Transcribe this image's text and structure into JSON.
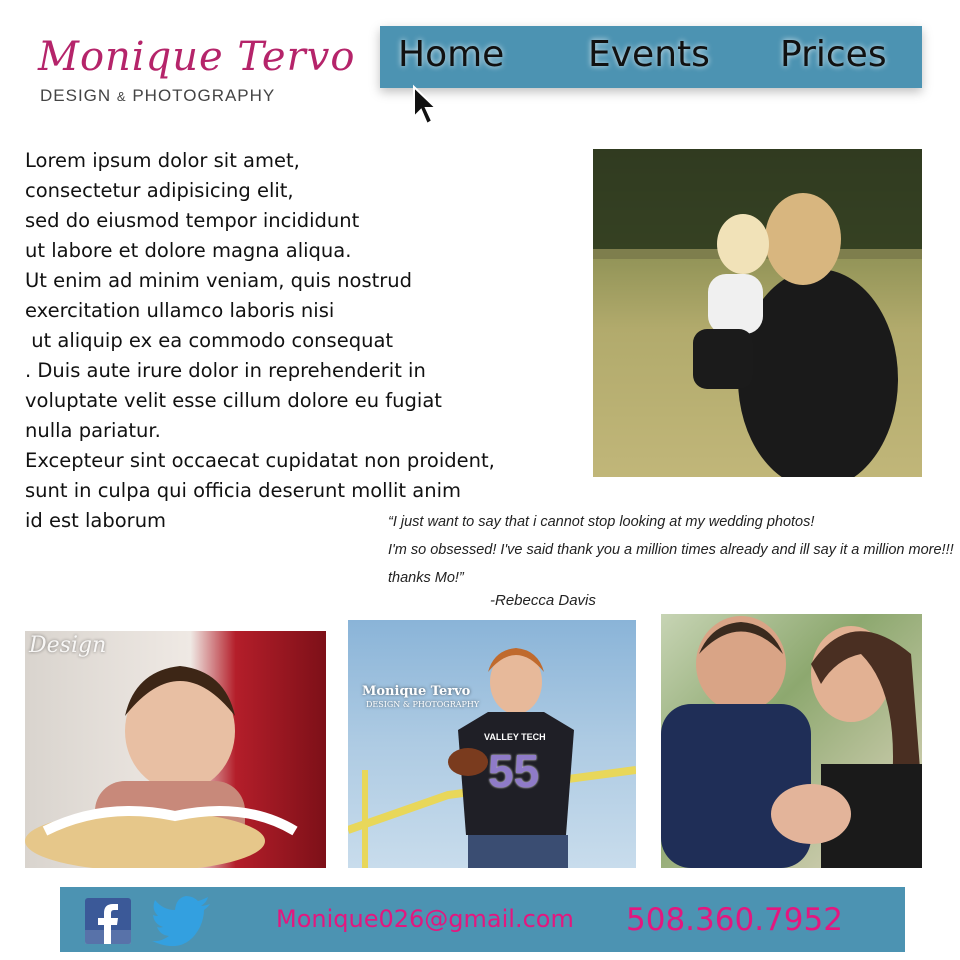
{
  "logo": {
    "script_text": "Monique Tervo",
    "subtitle_part1": "DESIGN",
    "subtitle_amp": "&",
    "subtitle_part2": "PHOTOGRAPHY"
  },
  "nav": {
    "items": [
      {
        "label": "Home"
      },
      {
        "label": "Events"
      },
      {
        "label": "Prices"
      }
    ],
    "bar_color": "#4c93b2"
  },
  "intro": {
    "lines": [
      "Lorem ipsum dolor sit amet,",
      "consectetur adipisicing elit,",
      "sed do eiusmod tempor incididunt",
      "ut labore et dolore magna aliqua.",
      "Ut enim ad minim veniam, quis nostrud",
      "exercitation ullamco laboris nisi",
      " ut aliquip ex ea commodo consequat",
      ". Duis aute irure dolor in reprehenderit in",
      "voluptate velit esse cillum dolore eu fugiat",
      "nulla pariatur.",
      "Excepteur sint occaecat cupidatat non proident,",
      "sunt in culpa qui officia deserunt mollit anim",
      "id est laborum"
    ]
  },
  "testimonial": {
    "lines": [
      "“I just want to say that i cannot stop looking at my wedding photos!",
      "I'm so obsessed! I've said thank you a million times already and ill say it a million more!!!",
      "thanks Mo!”"
    ],
    "author": "-Rebecca Davis"
  },
  "photos": {
    "baby_watermark": "Design",
    "senior_watermark": "Monique Tervo",
    "senior_watermark_sub": "DESIGN & PHOTOGRAPHY",
    "senior_jersey_text": "VALLEY TECH",
    "senior_jersey_number": "55"
  },
  "footer": {
    "email": "Monique026@gmail.com",
    "phone": "508.360.7952",
    "social_icons": [
      "facebook-icon",
      "twitter-icon"
    ],
    "accent_color": "#e3177f"
  },
  "colors": {
    "brand_pink": "#b5246a",
    "accent_blue": "#4c93b2"
  }
}
